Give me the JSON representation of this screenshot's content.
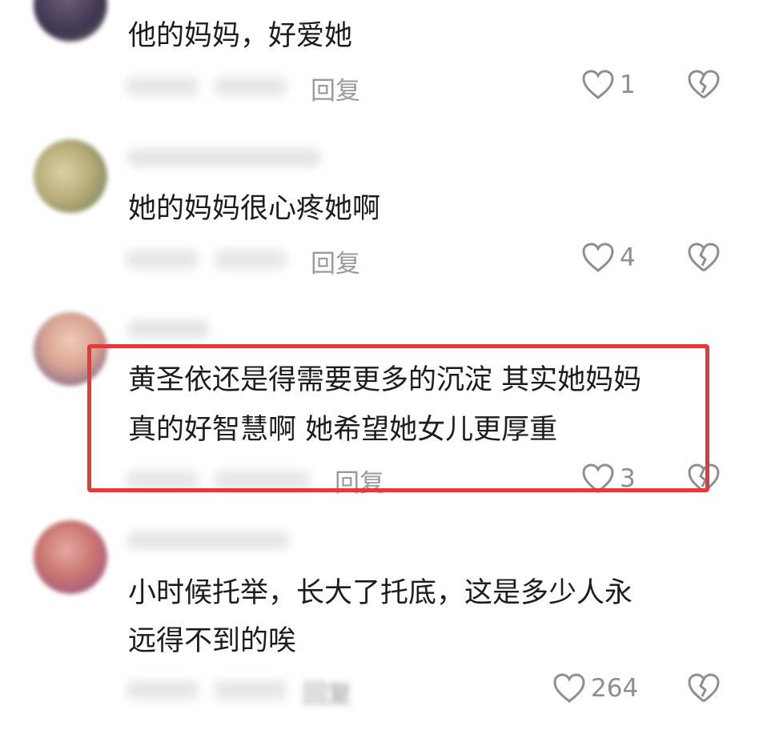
{
  "comments": [
    {
      "text_lines": [
        "他的妈妈，好爱她"
      ],
      "reply": "回复",
      "likes": "1"
    },
    {
      "text_lines": [
        "她的妈妈很心疼她啊"
      ],
      "reply": "回复",
      "likes": "4"
    },
    {
      "text_lines": [
        "黄圣依还是得需要更多的沉淀 其实她妈妈",
        "真的好智慧啊 她希望她女儿更厚重"
      ],
      "reply": "回复",
      "likes": "3",
      "highlighted": true
    },
    {
      "text_lines": [
        "小时候托举，长大了托底，这是多少人永",
        "远得不到的唉"
      ],
      "reply": "回复",
      "likes": "264"
    }
  ],
  "colors": {
    "highlight_border": "#e23a3a",
    "meta_text": "#9a9a9a"
  },
  "icons": {
    "like": "heart-outline-icon",
    "dislike": "broken-heart-icon"
  }
}
